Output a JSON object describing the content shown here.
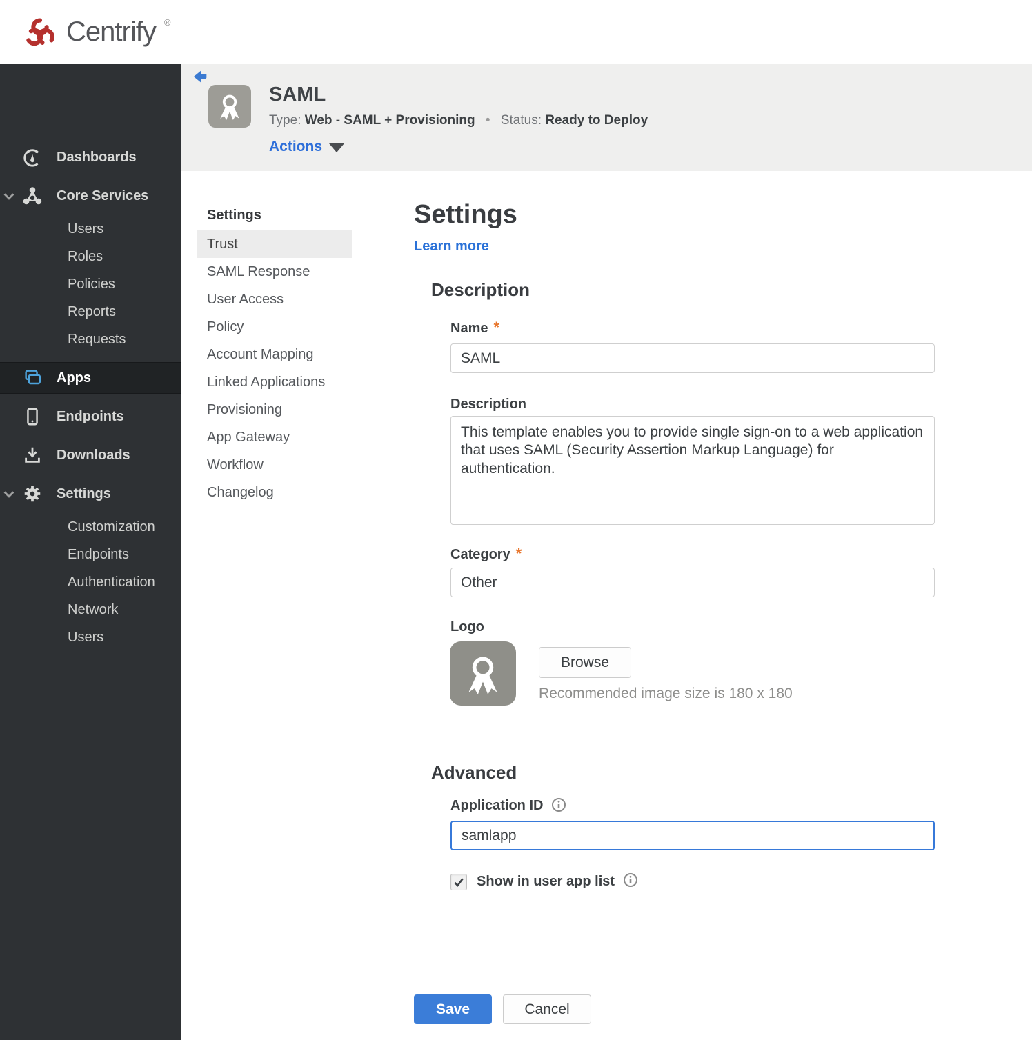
{
  "topbar": {
    "brand": "Centrify",
    "registered": "®"
  },
  "sidebar": {
    "dashboards": "Dashboards",
    "core_services": "Core Services",
    "core_children": {
      "users": "Users",
      "roles": "Roles",
      "policies": "Policies",
      "reports": "Reports",
      "requests": "Requests"
    },
    "apps": "Apps",
    "endpoints": "Endpoints",
    "downloads": "Downloads",
    "settings": "Settings",
    "settings_children": {
      "customization": "Customization",
      "endpoints": "Endpoints",
      "authentication": "Authentication",
      "network": "Network",
      "users": "Users"
    }
  },
  "header": {
    "title": "SAML",
    "type_label": "Type:",
    "type_value": "Web - SAML + Provisioning",
    "separator": "•",
    "status_label": "Status:",
    "status_value": "Ready to Deploy",
    "actions_label": "Actions"
  },
  "subnav": {
    "header": "Settings",
    "active": "Trust",
    "items": [
      "Trust",
      "SAML Response",
      "User Access",
      "Policy",
      "Account Mapping",
      "Linked Applications",
      "Provisioning",
      "App Gateway",
      "Workflow",
      "Changelog"
    ]
  },
  "main": {
    "title": "Settings",
    "learn_more": "Learn more",
    "required_marker": "*",
    "description_section": {
      "heading": "Description",
      "name_label": "Name",
      "name_value": "SAML",
      "description_label": "Description",
      "description_value": "This template enables you to provide single sign-on to a web application that uses SAML (Security Assertion Markup Language) for authentication.",
      "category_label": "Category",
      "category_value": "Other",
      "logo_label": "Logo",
      "browse_label": "Browse",
      "logo_hint": "Recommended image size is 180 x 180"
    },
    "advanced_section": {
      "heading": "Advanced",
      "application_id_label": "Application ID",
      "application_id_value": "samlapp",
      "show_in_app_list_label": "Show in user app list",
      "checkbox_checked": true
    },
    "save_label": "Save",
    "cancel_label": "Cancel"
  },
  "colors": {
    "brand_red": "#b5312e",
    "accent_blue": "#3b7dd8",
    "link_blue": "#2b72d8",
    "status_red": "#a8281e",
    "apps_icon_blue": "#4da3dc",
    "sidebar_bg": "#2e3134",
    "header_bg": "#efefee",
    "required_orange": "#e8762d"
  }
}
